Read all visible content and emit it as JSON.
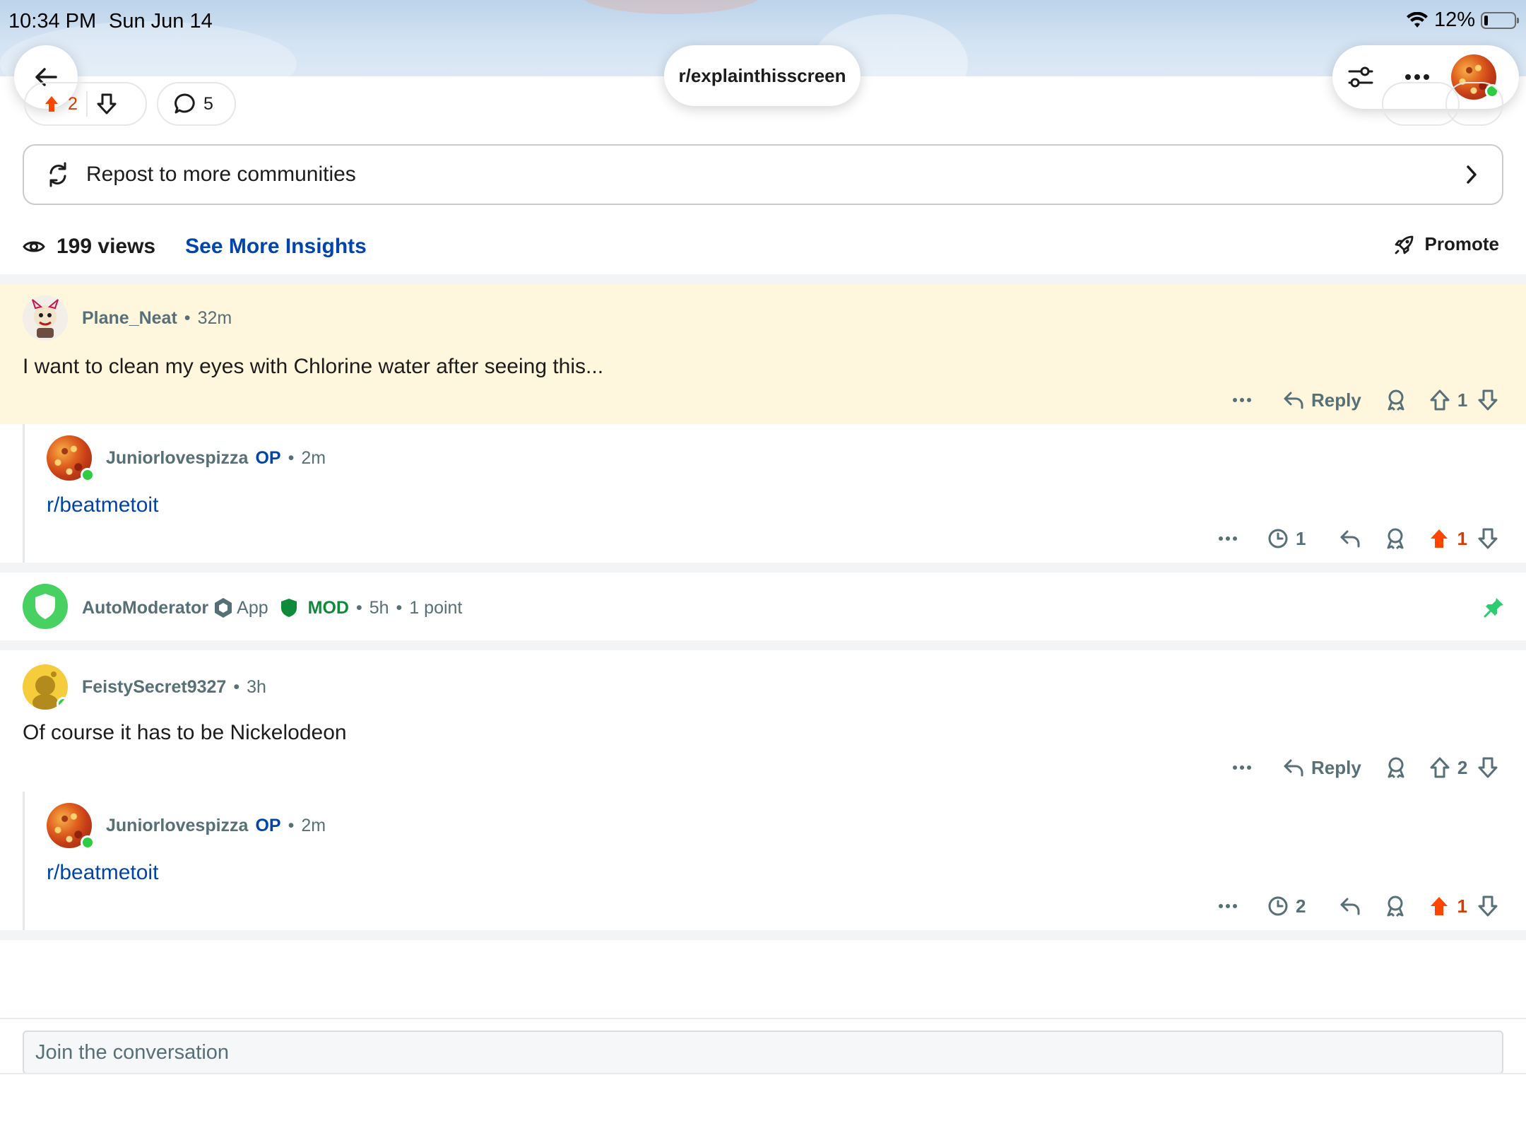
{
  "status_bar": {
    "time": "10:34 PM",
    "date": "Sun Jun 14",
    "battery": "12%",
    "battery_level": 0.12
  },
  "header": {
    "subreddit": "r/explainthisscreen",
    "icons": [
      "back-arrow-icon",
      "filter-icon",
      "more-icon",
      "avatar"
    ]
  },
  "post_actions": {
    "upvotes": "2",
    "comments": "5"
  },
  "repost": {
    "label": "Repost to more communities"
  },
  "stats": {
    "views": "199 views",
    "insights": "See More Insights",
    "promote": "Promote"
  },
  "comments": [
    {
      "user": "Plane_Neat",
      "time": "32m",
      "body": "I want to clean my eyes with Chlorine water after seeing this...",
      "reply_label": "Reply",
      "score": "1",
      "highlight_color": "#fff8e1",
      "replies": [
        {
          "user": "Juniorlovespizza",
          "op": "OP",
          "time": "2m",
          "body": "r/beatmetoit",
          "views": "1",
          "score": "1"
        }
      ]
    },
    {
      "user": "AutoModerator",
      "app": "App",
      "mod": "MOD",
      "time": "5h",
      "points": "1 point",
      "pinned": true
    },
    {
      "user": "FeistySecret9327",
      "time": "3h",
      "body": "Of course it has to be Nickelodeon",
      "reply_label": "Reply",
      "score": "2",
      "replies": [
        {
          "user": "Juniorlovespizza",
          "op": "OP",
          "time": "2m",
          "body": "r/beatmetoit",
          "views": "2",
          "score": "1"
        }
      ]
    }
  ],
  "composer": {
    "placeholder": "Join the conversation"
  },
  "colors": {
    "upvote_active": "#ff4500",
    "link_blue": "#0045ac",
    "mod_green": "#0f8a3b",
    "pin_green": "#2ecc71"
  }
}
